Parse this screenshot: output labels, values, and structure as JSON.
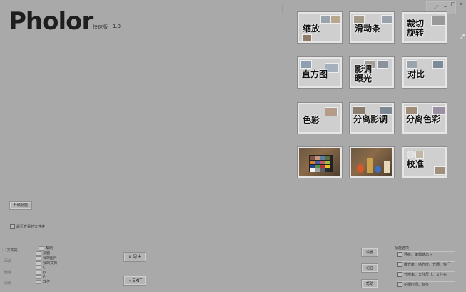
{
  "app": {
    "logo": "Pholor",
    "edition": "快速版",
    "version": "1.3"
  },
  "window_controls": [
    "_",
    "□",
    "✕"
  ],
  "tiles": [
    {
      "name": "zoom",
      "label": "缩放"
    },
    {
      "name": "slider",
      "label": "滑动条"
    },
    {
      "name": "crop-rotate",
      "label": "裁切\n旋转"
    },
    {
      "name": "histogram",
      "label": "直方图"
    },
    {
      "name": "tone-exposure",
      "label": "影调\n曝光"
    },
    {
      "name": "contrast",
      "label": "对比"
    },
    {
      "name": "color",
      "label": "色彩"
    },
    {
      "name": "split-tone",
      "label": "分离影调"
    },
    {
      "name": "split-color",
      "label": "分离色彩"
    },
    {
      "name": "photo-colorchecker",
      "label": ""
    },
    {
      "name": "photo-toys",
      "label": ""
    },
    {
      "name": "calibrate",
      "label": "校准"
    }
  ],
  "upgrade_button": "升级功能",
  "recent_files_label": "最近查看的文件夹",
  "files_label": "文件夹",
  "left_side_buttons": [
    "添加",
    "删除",
    "清除"
  ],
  "tree": [
    "帮助",
    "桌面",
    "我的图片",
    "我的文档",
    "C:",
    "D:",
    "E:",
    "软件"
  ],
  "import_button": "导出",
  "exit_button": "EXIT",
  "right_buttons": [
    "设置",
    "语言",
    "帮助"
  ],
  "options_panel": {
    "title": "功能选项",
    "items": [
      "评级、编辑状态 ✓",
      "曝光度、感光度、光圈、快门",
      "分辨率、文件尺寸、文件名",
      "拍摄时间、标签"
    ]
  }
}
